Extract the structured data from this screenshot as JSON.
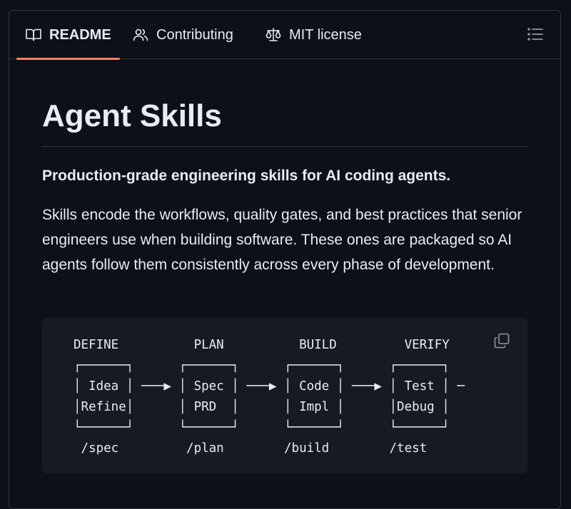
{
  "tabs": [
    {
      "label": "README",
      "icon": "book-icon",
      "active": true
    },
    {
      "label": "Contributing",
      "icon": "people-icon",
      "active": false
    },
    {
      "label": "MIT license",
      "icon": "law-icon",
      "active": false
    }
  ],
  "outline_icon": "list-unordered-icon",
  "readme": {
    "title": "Agent Skills",
    "tagline": "Production-grade engineering skills for AI coding agents.",
    "description": "Skills encode the workflows, quality gates, and best practices that senior engineers use when building software. These ones are packaged so AI agents follow them consistently across every phase of development.",
    "code_block": {
      "text": "DEFINE          PLAN          BUILD         VERIFY\n┌──────┐      ┌──────┐      ┌──────┐      ┌──────┐\n│ Idea │ ───▶ │ Spec │ ───▶ │ Code │ ───▶ │ Test │ ─\n│Refine│      │ PRD  │      │ Impl │      │Debug │\n└──────┘      └──────┘      └──────┘      └──────┘\n /spec         /plan        /build        /test",
      "copy_icon": "copy-icon"
    }
  },
  "colors": {
    "background": "#0d1117",
    "border": "#30363d",
    "active_tab_underline": "#f78166",
    "code_background": "#161b22",
    "text": "#e6edf3"
  }
}
